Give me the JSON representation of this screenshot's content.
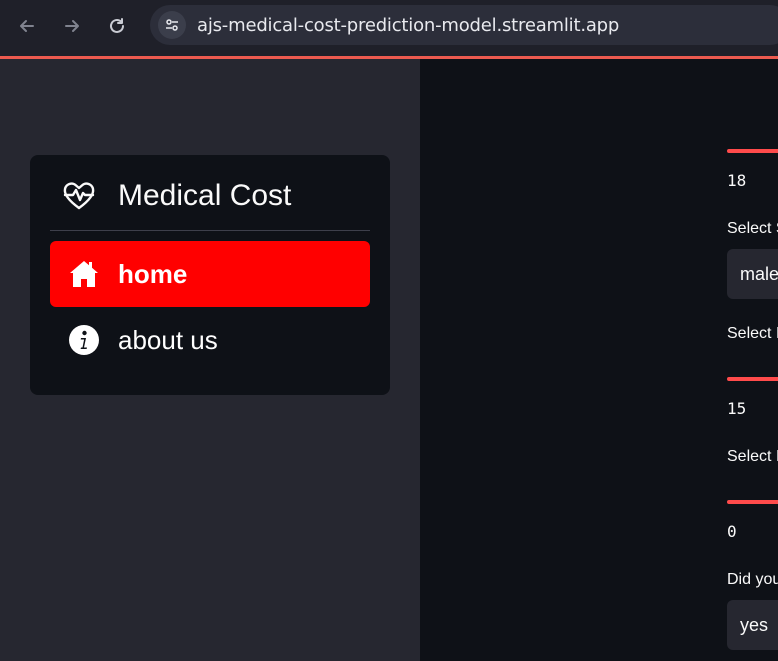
{
  "browser": {
    "url": "ajs-medical-cost-prediction-model.streamlit.app",
    "back_icon": "arrow-left-icon",
    "forward_icon": "arrow-right-icon",
    "reload_icon": "reload-icon",
    "site_info_icon": "tune-icon"
  },
  "sidebar": {
    "title": "Medical Cost",
    "logo_icon": "heart-pulse-icon",
    "items": [
      {
        "label": "home",
        "icon": "house-icon",
        "selected": true
      },
      {
        "label": "about us",
        "icon": "info-circle-icon",
        "selected": false
      }
    ],
    "selected_color": "#ff0000"
  },
  "main": {
    "age_value": "18",
    "sex_label": "Select S",
    "sex_value": "male",
    "bmi_label": "Select I",
    "bmi_value": "15",
    "children_label": "Select I",
    "children_value": "0",
    "smoker_label": "Did you",
    "smoker_value": "yes",
    "accent_color": "#ff4b4b"
  }
}
